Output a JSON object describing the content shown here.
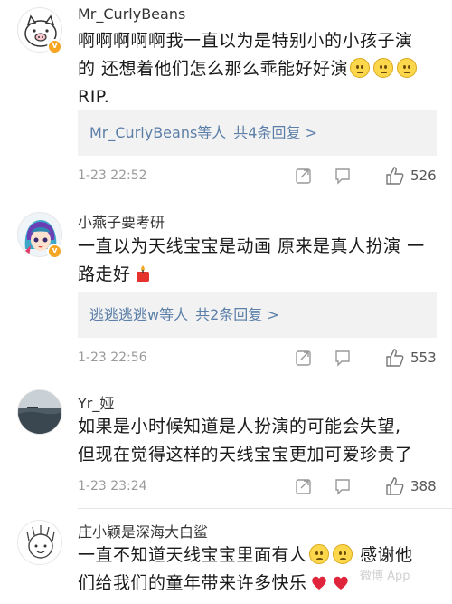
{
  "colors": {
    "link": "#5b7fa8",
    "badge": "#f5a623",
    "divider": "#e5e5e5",
    "reply_bg": "#f2f2f2"
  },
  "comments": [
    {
      "username": "Mr_CurlyBeans",
      "text1": "啊啊啊啊啊我一直以为是特别小的小孩子演",
      "text2": "的 还想着他们怎么那么乖能好好演",
      "text3": "RIP.",
      "reply_users": "Mr_CurlyBeans等人",
      "reply_count": "共4条回复 >",
      "time": "1-23 22:52",
      "likes": "526",
      "avatar_icon": "piglet-avatar"
    },
    {
      "username": "小燕子要考研",
      "text1": "一直以为天线宝宝是动画 原来是真人扮演 一",
      "text2": "路走好",
      "reply_users": "逃逃逃逃w等人",
      "reply_count": "共2条回复 >",
      "time": "1-23 22:56",
      "likes": "553",
      "avatar_icon": "anime-girl-avatar"
    },
    {
      "username": "Yr_娅",
      "text1": "如果是小时候知道是人扮演的可能会失望,",
      "text2": "但现在觉得这样的天线宝宝更加可爱珍贵了",
      "time": "1-23 23:24",
      "likes": "388",
      "avatar_icon": "ocean-photo-avatar"
    },
    {
      "username": "庄小颖是深海大白鲨",
      "text1": "一直不知道天线宝宝里面有人",
      "text1b": "感谢他",
      "text2": "们给我们的童年带来许多快乐",
      "avatar_icon": "cartoon-avatar"
    }
  ],
  "watermark": "微博 App"
}
